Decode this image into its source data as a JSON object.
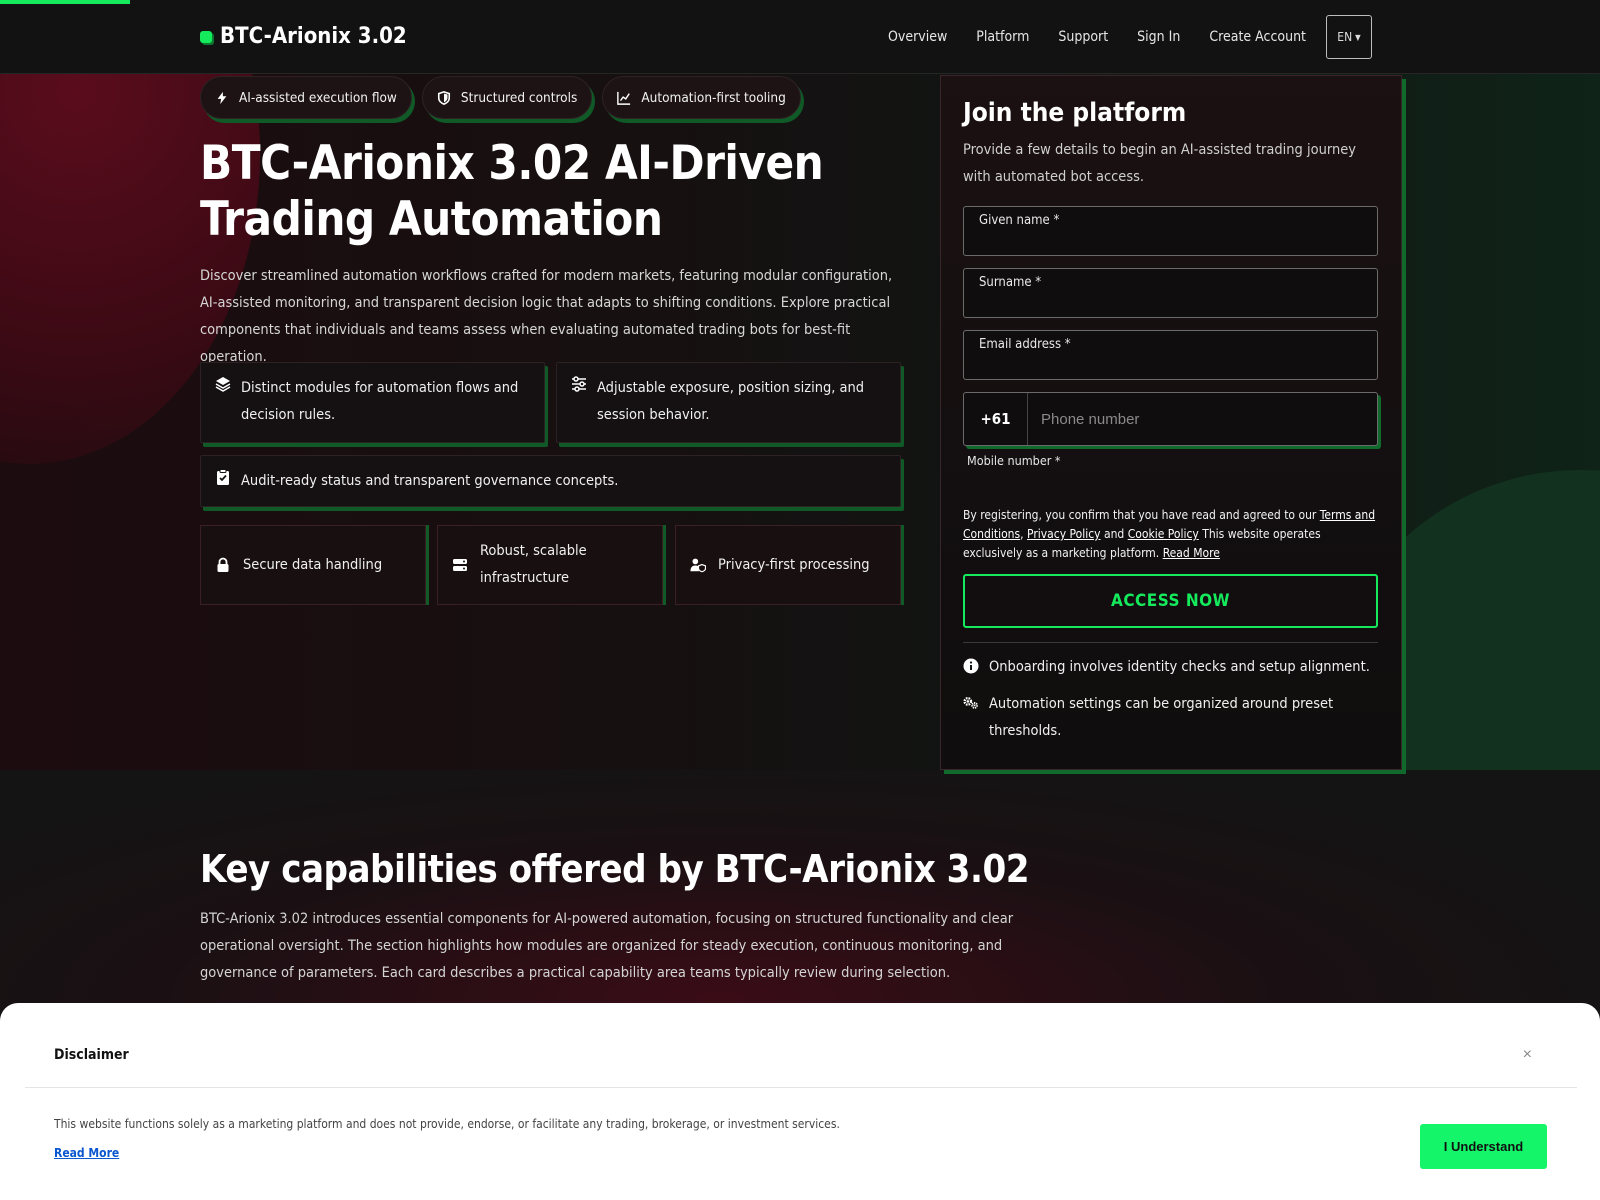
{
  "brand": {
    "name": "BTC-Arionix 3.02",
    "accent": "#14ea5c"
  },
  "nav": {
    "items": [
      "Overview",
      "Platform",
      "Support",
      "Sign In",
      "Create Account"
    ],
    "language": "EN"
  },
  "hero": {
    "chips": [
      "AI-assisted execution flow",
      "Structured controls",
      "Automation-first tooling"
    ],
    "title": "BTC-Arionix 3.02 AI-Driven Trading Automation",
    "description": "Discover streamlined automation workflows crafted for modern markets, featuring modular configuration, AI-assisted monitoring, and transparent decision logic that adapts to shifting conditions. Explore practical components that individuals and teams assess when evaluating automated trading bots for best-fit operation.",
    "features": [
      "Distinct modules for automation flows and decision rules.",
      "Adjustable exposure, position sizing, and session behavior.",
      "Audit-ready status and transparent governance concepts."
    ],
    "badges": [
      "Secure data handling",
      "Robust, scalable infrastructure",
      "Privacy-first processing"
    ]
  },
  "form": {
    "title": "Join the platform",
    "subtitle": "Provide a few details to begin an AI-assisted trading journey with automated bot access.",
    "given_name_label": "Given name *",
    "surname_label": "Surname *",
    "email_label": "Email address *",
    "phone_code": "+61",
    "phone_placeholder": "Phone number",
    "phone_label": "Mobile number *",
    "legal_prefix": "By registering, you confirm that you have read and agreed to our",
    "terms_link": "Terms and Conditions",
    "privacy_link": "Privacy Policy",
    "and": "and",
    "cookie_link": "Cookie Policy",
    "legal_suffix": "This website operates exclusively as a marketing platform.",
    "read_more": "Read More",
    "submit": "ACCESS NOW",
    "notes": [
      "Onboarding involves identity checks and setup alignment.",
      "Automation settings can be organized around preset thresholds."
    ]
  },
  "capabilities": {
    "title": "Key capabilities offered by BTC-Arionix 3.02",
    "description": "BTC-Arionix 3.02 introduces essential components for AI-powered automation, focusing on structured functionality and clear operational oversight. The section highlights how modules are organized for steady execution, continuous monitoring, and governance of parameters. Each card describes a practical capability area teams typically review during selection."
  },
  "disclaimer": {
    "title": "Disclaimer",
    "close": "×",
    "text": "This website functions solely as a marketing platform and does not provide, endorse, or facilitate any trading, brokerage, or investment services.",
    "read_more": "Read More",
    "button": "I Understand"
  }
}
